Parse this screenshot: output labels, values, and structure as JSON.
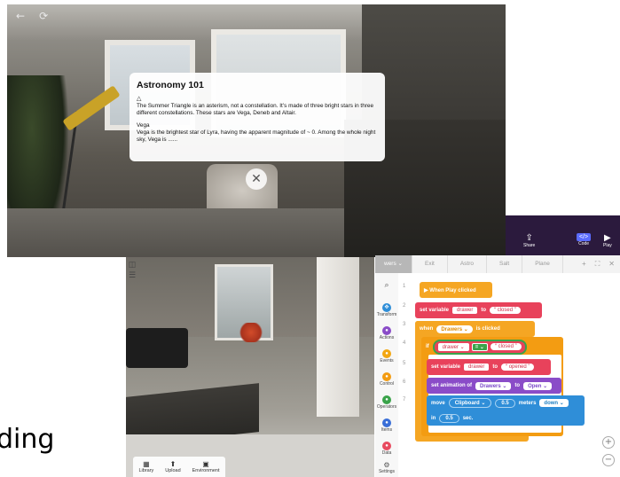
{
  "top_scene": {
    "nav": {
      "back_icon": "←",
      "refresh_icon": "⟳"
    },
    "card": {
      "title": "Astronomy 101",
      "triangle_glyph": "△",
      "para1": "The Summer Triangle is an asterism, not a constellation. It’s made of three bright stars in three different constellations. These stars are Vega, Deneb and Altair.",
      "sub_title": "Vega",
      "para2": "Vega is the brightest star of Lyra, having the apparent magnitude of ~ 0. Among the whole night sky, Vega is ......"
    },
    "close_glyph": "✕"
  },
  "heading_partial": "ding",
  "header": {
    "buttons": [
      {
        "label": "Share",
        "glyph": "⇪"
      },
      {
        "label": "Code",
        "glyph": "</>"
      },
      {
        "label": "Play",
        "glyph": "▶"
      }
    ],
    "accent": "#2b1a3d"
  },
  "bottom_toolbar": [
    {
      "label": "Library",
      "glyph": "▦"
    },
    {
      "label": "Upload",
      "glyph": "⬆"
    },
    {
      "label": "Environment",
      "glyph": "▣"
    }
  ],
  "editor": {
    "tabs": [
      "Drawers",
      "Exit",
      "Astro",
      "Salt",
      "Plane"
    ],
    "active_tab_suffix": "wers ⌄",
    "tab_icons": {
      "add": "+",
      "expand": "⛶",
      "close": "✕"
    },
    "palette": [
      {
        "label": "",
        "glyph": "🔍",
        "color": "#f7f7f7"
      },
      {
        "label": "Transform",
        "glyph": "✥",
        "color": "#2f8ed8"
      },
      {
        "label": "Actions",
        "glyph": "●",
        "color": "#8a4cc8"
      },
      {
        "label": "Events",
        "glyph": "●",
        "color": "#f3a712"
      },
      {
        "label": "Control",
        "glyph": "●",
        "color": "#f39c12"
      },
      {
        "label": "Operators",
        "glyph": "●",
        "color": "#3aa34a"
      },
      {
        "label": "Items",
        "glyph": "●",
        "color": "#3a6fd8"
      },
      {
        "label": "Data",
        "glyph": "●",
        "color": "#e84a5f"
      },
      {
        "label": "Settings",
        "glyph": "⚙",
        "color": "#f7f7f7"
      }
    ],
    "line_numbers": [
      "1",
      "2",
      "3",
      "4",
      "5",
      "6",
      "7"
    ],
    "blocks": {
      "b1": {
        "label": "▶ When Play clicked"
      },
      "b2": {
        "set": "set variable",
        "var": "drawer",
        "to": "to",
        "val": "“ closed ”"
      },
      "b3": {
        "when": "when",
        "item": "Drawers ⌄",
        "clicked": "is clicked"
      },
      "b4": {
        "if": "if",
        "var": "drawer ⌄",
        "op": "= ⌄",
        "val": "“ closed ”"
      },
      "b5": {
        "set": "set variable",
        "var": "drawer",
        "to": "to",
        "val": "“ opened ”"
      },
      "b6": {
        "set": "set animation of",
        "item": "Drawers ⌄",
        "to": "to",
        "val": "Open ⌄"
      },
      "b7": {
        "move": "move",
        "item": "Clipboard ⌄",
        "amount": "0.5",
        "unit": "meters",
        "dir": "down ⌄",
        "in": "in",
        "time": "0.5",
        "sec": "sec."
      }
    },
    "zoom_in": "+",
    "zoom_out": "−"
  }
}
